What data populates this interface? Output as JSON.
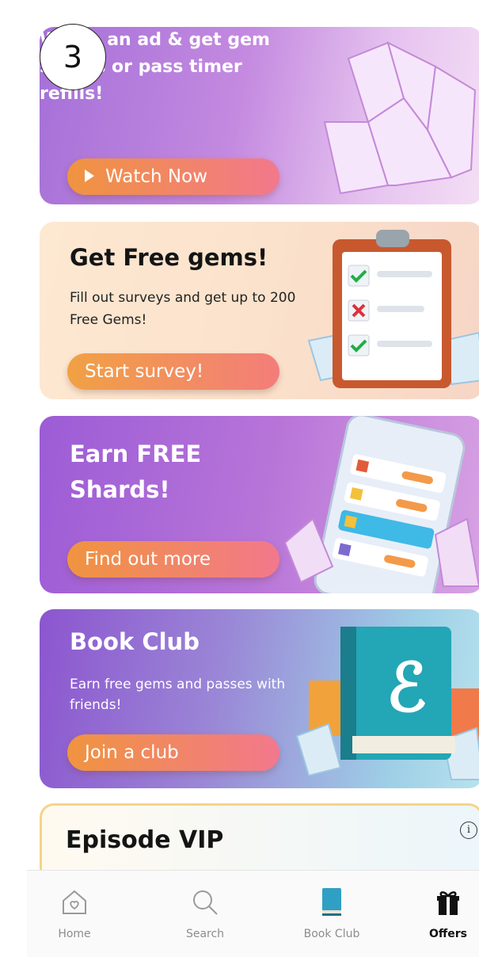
{
  "step_number": "3",
  "cards": {
    "watch": {
      "text": "Watch an ad & get gem shards or pass timer refills!",
      "cta": "Watch Now"
    },
    "survey": {
      "title": "Get Free gems!",
      "desc": "Fill out surveys and get up to 200 Free Gems!",
      "cta": "Start survey!"
    },
    "shards": {
      "title": "Earn FREE Shards!",
      "cta": "Find out more"
    },
    "club": {
      "title": "Book Club",
      "desc": "Earn free gems and passes with friends!",
      "cta": "Join a club"
    },
    "vip": {
      "title": "Episode VIP"
    }
  },
  "nav": [
    {
      "label": "Home",
      "icon": "home-icon"
    },
    {
      "label": "Search",
      "icon": "search-icon"
    },
    {
      "label": "Book Club",
      "icon": "book-icon"
    },
    {
      "label": "Offers",
      "icon": "gift-icon"
    }
  ],
  "nav_active": "Offers",
  "colors": {
    "accent_orange": "#f0943f",
    "accent_pink": "#f2788c",
    "purple": "#a570d8"
  }
}
